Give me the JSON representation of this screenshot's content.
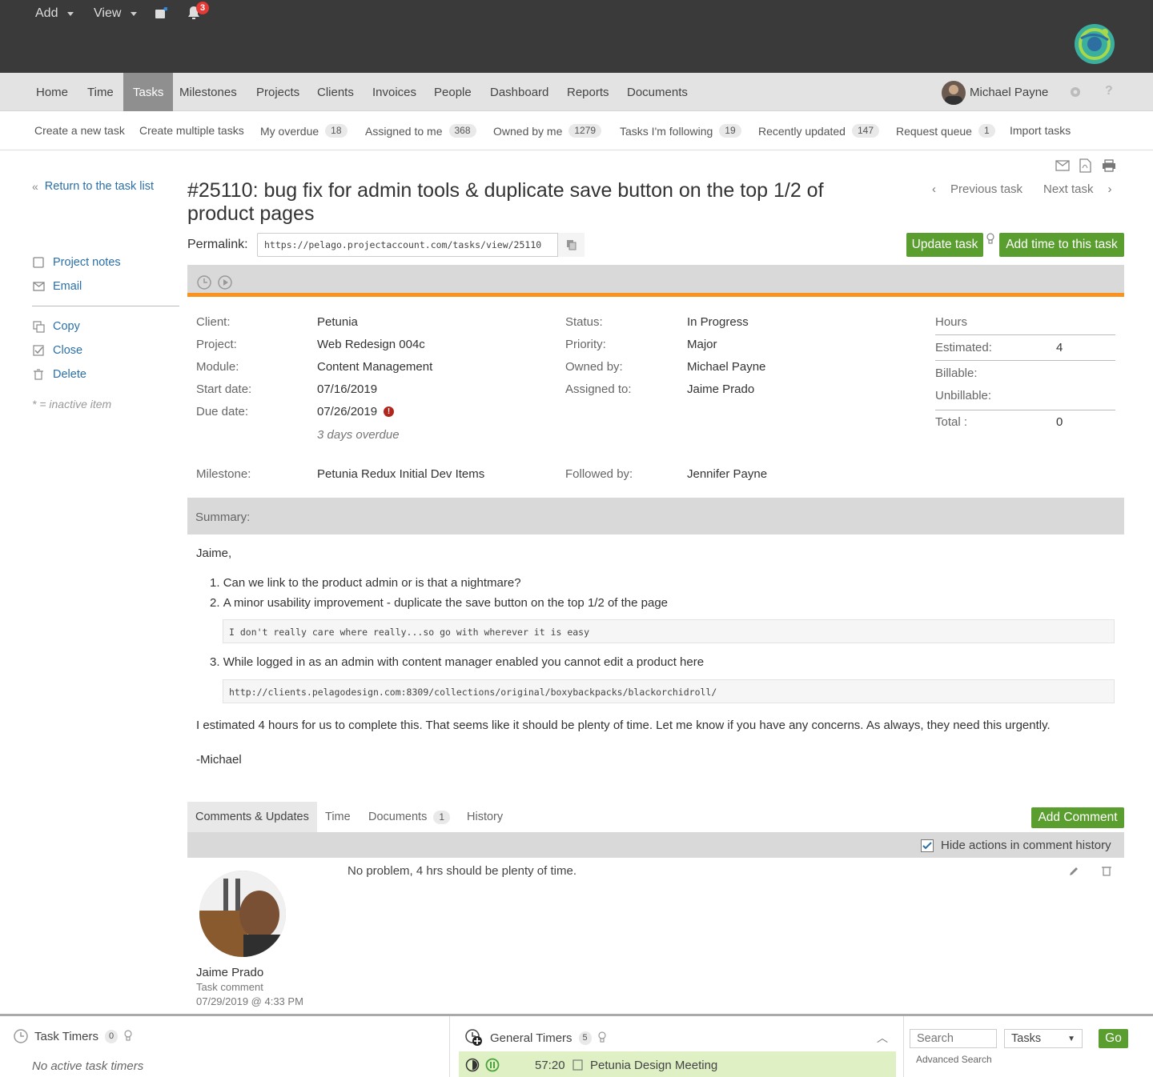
{
  "topbar": {
    "add_label": "Add",
    "view_label": "View",
    "notification_count": "3"
  },
  "nav": {
    "items": [
      "Home",
      "Time",
      "Tasks",
      "Milestones",
      "Projects",
      "Clients",
      "Invoices",
      "People",
      "Dashboard",
      "Reports",
      "Documents"
    ],
    "active": "Tasks",
    "user_name": "Michael Payne"
  },
  "subnav": {
    "create_task": "Create a new task",
    "create_multiple": "Create multiple tasks",
    "my_overdue": "My overdue",
    "my_overdue_count": "18",
    "assigned": "Assigned to me",
    "assigned_count": "368",
    "owned": "Owned by me",
    "owned_count": "1279",
    "following": "Tasks I'm following",
    "following_count": "19",
    "recent": "Recently updated",
    "recent_count": "147",
    "queue": "Request queue",
    "queue_count": "1",
    "import": "Import tasks"
  },
  "sidebar": {
    "return": "Return to the task list",
    "project_notes": "Project notes",
    "email": "Email",
    "copy": "Copy",
    "close": "Close",
    "delete": "Delete",
    "inactive_note": "* = inactive item"
  },
  "task": {
    "title": "#25110: bug fix for admin tools & duplicate save button on the top 1/2 of product pages",
    "permalink_label": "Permalink:",
    "permalink": "https://pelago.projectaccount.com/tasks/view/25110",
    "prev": "Previous task",
    "next": "Next task",
    "update_btn": "Update task",
    "add_time_btn": "Add time to this task"
  },
  "details": {
    "client_label": "Client:",
    "client": "Petunia",
    "project_label": "Project:",
    "project": "Web Redesign 004c",
    "module_label": "Module:",
    "module": "Content Management",
    "start_label": "Start date:",
    "start": "07/16/2019",
    "due_label": "Due date:",
    "due": "07/26/2019",
    "overdue": "3 days overdue",
    "milestone_label": "Milestone:",
    "milestone": "Petunia Redux Initial Dev Items",
    "status_label": "Status:",
    "status": "In Progress",
    "priority_label": "Priority:",
    "priority": "Major",
    "owned_label": "Owned by:",
    "owned": "Michael Payne",
    "assigned_label": "Assigned to:",
    "assigned": "Jaime Prado",
    "followed_label": "Followed by:",
    "followed": "Jennifer Payne"
  },
  "hours": {
    "heading": "Hours",
    "estimated_label": "Estimated:",
    "estimated": "4",
    "billable_label": "Billable:",
    "unbillable_label": "Unbillable:",
    "total_label": "Total :",
    "total": "0"
  },
  "summary": {
    "label": "Summary:",
    "greeting": "Jaime,",
    "item1": "Can we link to the product admin or is that a nightmare?",
    "item2": "A minor usability improvement - duplicate the save button on the top 1/2 of the page",
    "code1": "I don't really care where really...so go with wherever it is easy",
    "item3": "While logged in as an admin with content manager enabled you cannot edit a product here",
    "code2": "http://clients.pelagodesign.com:8309/collections/original/boxybackpacks/blackorchidroll/",
    "paragraph": "I estimated 4 hours for us to complete this. That seems like it should be plenty of time. Let me know if you have any concerns. As always, they need this urgently.",
    "signoff": "-Michael"
  },
  "tabs": {
    "comments": "Comments & Updates",
    "time": "Time",
    "documents": "Documents",
    "documents_count": "1",
    "history": "History",
    "add_comment": "Add Comment",
    "hide_actions": "Hide actions in comment history"
  },
  "comment": {
    "text": "No problem, 4 hrs should be plenty of time.",
    "author": "Jaime Prado",
    "type": "Task comment",
    "date": "07/29/2019 @ 4:33 PM"
  },
  "footer": {
    "task_timers": "Task Timers",
    "task_timers_count": "0",
    "no_active": "No active task timers",
    "general_timers": "General Timers",
    "general_timers_count": "5",
    "timer_time": "57:20",
    "timer_name": "Petunia Design Meeting",
    "search_placeholder": "Search",
    "search_scope": "Tasks",
    "go": "Go",
    "advanced": "Advanced Search"
  },
  "colors": {
    "accent_green": "#5a9e2f",
    "accent_orange": "#f7931e",
    "link_blue": "#2a6fa8"
  }
}
